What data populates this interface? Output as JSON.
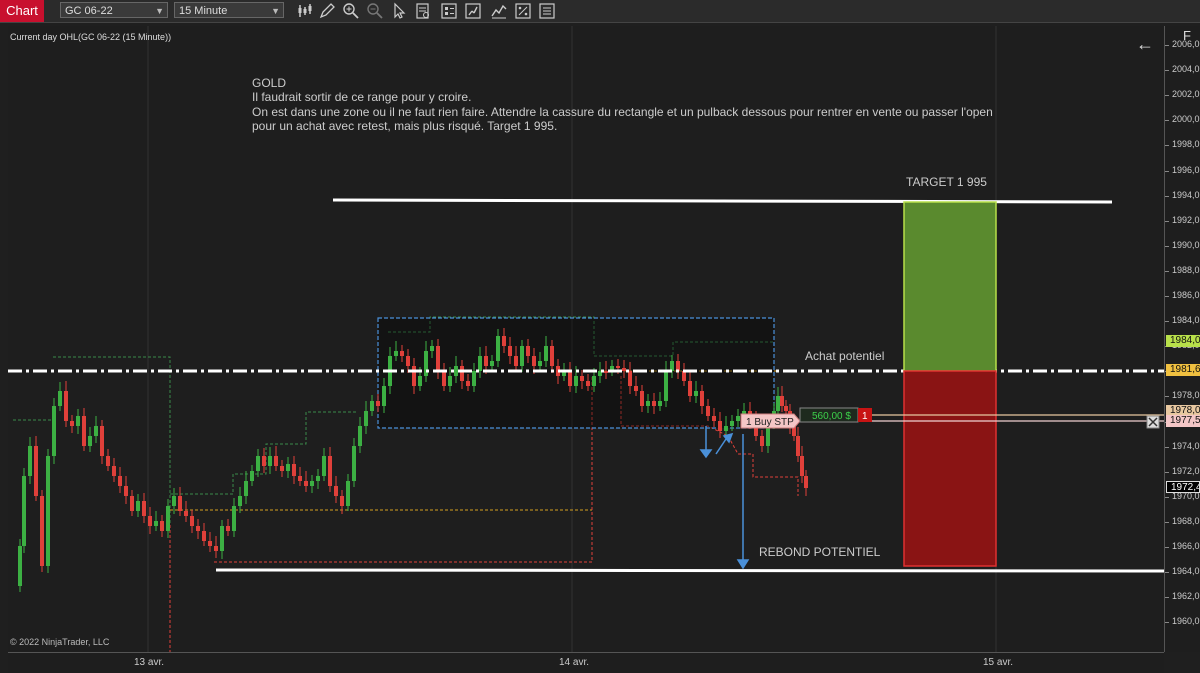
{
  "toolbar": {
    "chart_tab": "Chart",
    "instrument": "GC 06-22",
    "interval": "15 Minute",
    "tools": [
      "bar-type-icon",
      "pencil-icon",
      "zoom-in-icon",
      "zoom-out-icon",
      "cursor-icon",
      "data-box-icon",
      "properties-icon",
      "strategies-icon",
      "indicators-icon",
      "templates-icon"
    ]
  },
  "chart": {
    "indicator_label": "Current day OHL(GC 06-22 (15 Minute))",
    "copyright": "© 2022 NinjaTrader, LLC",
    "back_arrow": "←",
    "corner_letter": "F"
  },
  "annotation": {
    "title": "GOLD",
    "line1": "Il faudrait sortir de ce range pour y croire.",
    "line2": "On est dans une zone ou il ne faut rien faire. Attendre la cassure du rectangle et un pulback dessous pour rentrer en vente ou passer l'open",
    "line3": "pour un achat avec retest, mais plus risqué. Target 1 995.",
    "target_label": "TARGET 1 995",
    "achat_label": "Achat potentiel",
    "rebond_label": "REBOND POTENTIEL"
  },
  "order": {
    "label": "1  Buy STP",
    "pnl": "560,00 $",
    "qty": "1",
    "close_icon": "close-icon"
  },
  "price_axis": {
    "ticks": [
      "2006,0",
      "2004,0",
      "2002,0",
      "2000,0",
      "1998,0",
      "1996,0",
      "1994,0",
      "1992,0",
      "1990,0",
      "1988,0",
      "1986,0",
      "1984,0",
      "1982,0",
      "1980,0",
      "1978,0",
      "1976,0",
      "1974,0",
      "1972,0",
      "1970,0",
      "1968,0",
      "1966,0",
      "1964,0",
      "1962,0",
      "1960,0"
    ],
    "tag_target": "1984,0",
    "tag_achat": "1981,6",
    "tag_order": "1977,5",
    "tag_hidden": "1978,0",
    "tag_last": "1972,4"
  },
  "time_axis": {
    "labels": [
      "13 avr.",
      "14 avr.",
      "15 avr."
    ]
  },
  "colors": {
    "up": "#3cb043",
    "down": "#e0403a",
    "target_green": "#5a8a2e",
    "stop_red": "#8a1414",
    "box_blue": "#4a90d9"
  }
}
